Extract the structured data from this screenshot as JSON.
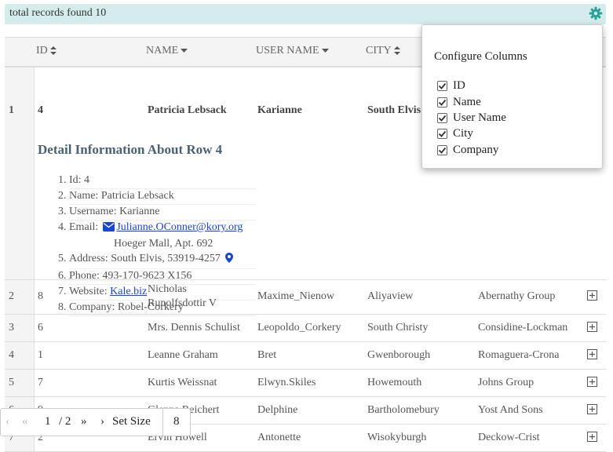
{
  "topbar": {
    "records_text": "total records found 10",
    "settings_icon": "gear-icon",
    "accent": "#2aa198"
  },
  "columns": [
    {
      "label": "ID",
      "sort_icon": "sort-both-icon"
    },
    {
      "label": "NAME",
      "sort_icon": "sort-down-icon"
    },
    {
      "label": "USER NAME",
      "sort_icon": "sort-down-icon"
    },
    {
      "label": "CITY",
      "sort_icon": "sort-both-icon"
    }
  ],
  "expanded_row": {
    "index": "1",
    "id": "4",
    "name": "Patricia Lebsack",
    "username": "Karianne",
    "city": "South Elvis",
    "detail": {
      "heading": "Detail Information About Row 4",
      "items": {
        "id": "Id: 4",
        "name": "Name: Patricia Lebsack",
        "username": "Username: Karianne",
        "email_label": "Email:",
        "email": "Julianne.OConner@kory.org",
        "email_extra": "Hoeger Mall, Apt. 692",
        "address": "Address: South Elvis, 53919-4257",
        "phone": "Phone: 493-170-9623 X156",
        "website_label": "Website:",
        "website": "Kale.biz",
        "company": "Company: Robel-Corkery"
      }
    }
  },
  "rows": [
    {
      "index": "2",
      "id": "8",
      "name_line1": "Nicholas",
      "name_line2": "Runolfsdottir V",
      "username": "Maxime_Nienow",
      "city": "Aliyaview",
      "company": "Abernathy Group"
    },
    {
      "index": "3",
      "id": "6",
      "name": "Mrs. Dennis Schulist",
      "username": "Leopoldo_Corkery",
      "city": "South Christy",
      "company": "Considine-Lockman"
    },
    {
      "index": "4",
      "id": "1",
      "name": "Leanne Graham",
      "username": "Bret",
      "city": "Gwenborough",
      "company": "Romaguera-Crona"
    },
    {
      "index": "5",
      "id": "7",
      "name": "Kurtis Weissnat",
      "username": "Elwyn.Skiles",
      "city": "Howemouth",
      "company": "Johns Group"
    },
    {
      "index": "6",
      "id": "9",
      "name": "Glenna Reichert",
      "username": "Delphine",
      "city": "Bartholomebury",
      "company": "Yost And Sons"
    },
    {
      "index": "7",
      "id": "2",
      "name": "Ervin Howell",
      "username": "Antonette",
      "city": "Wisokyburgh",
      "company": "Deckow-Crist"
    }
  ],
  "configure_columns": {
    "title": "Configure Columns",
    "options": [
      {
        "label": "ID",
        "checked": true
      },
      {
        "label": "Name",
        "checked": true
      },
      {
        "label": "User Name",
        "checked": true
      },
      {
        "label": "City",
        "checked": true
      },
      {
        "label": "Company",
        "checked": true
      }
    ]
  },
  "pager": {
    "prev": "‹",
    "first": "«",
    "current_page": "1",
    "total": "/ 2",
    "last": "»",
    "next": "›",
    "set_size_label": "Set Size",
    "size": "8"
  }
}
